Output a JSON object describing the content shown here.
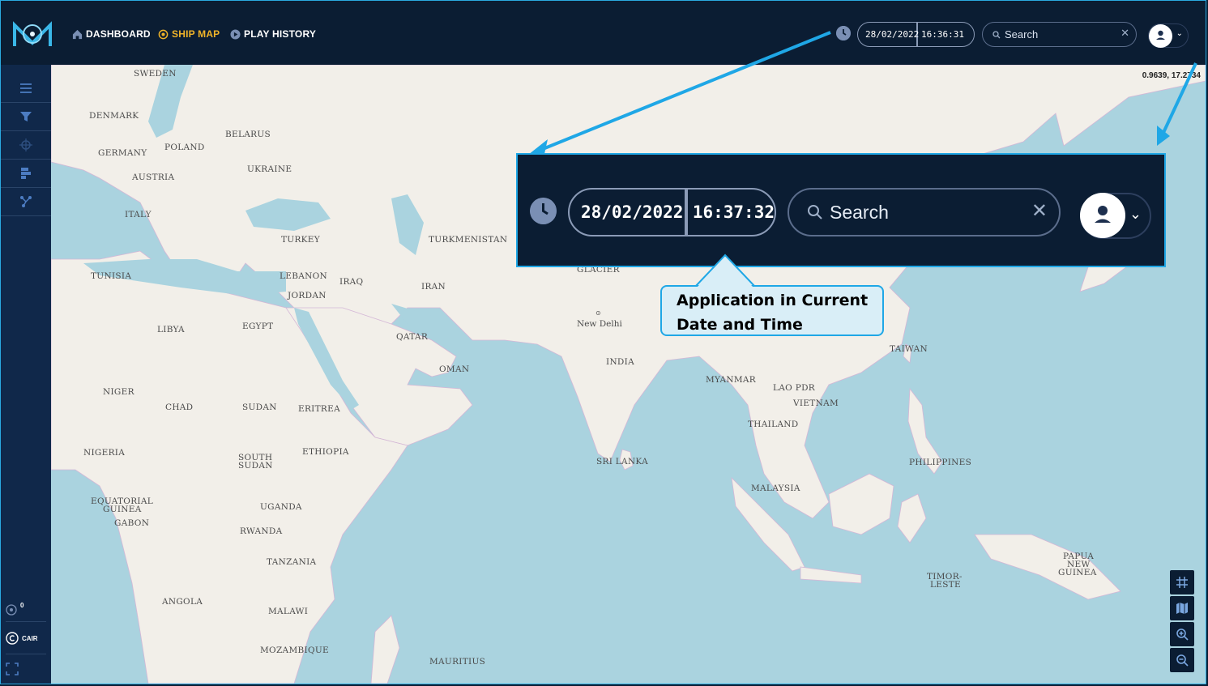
{
  "nav": {
    "dashboard": "DASHBOARD",
    "ship_map": "SHIP MAP",
    "play_history": "PLAY HISTORY"
  },
  "header": {
    "date": "28/02/2022",
    "time_small": "16:36:31",
    "time": "16:37:32",
    "search_placeholder": "Search"
  },
  "sidebar": {
    "icons": [
      "menu-icon",
      "filter-icon",
      "crosshair-icon",
      "layers-icon",
      "network-icon"
    ],
    "bottom": {
      "zoom_level": "0",
      "brand": "CAIR"
    }
  },
  "map": {
    "coordinates": "0.9639, 17.2734",
    "labels": {
      "sweden": "SWEDEN",
      "denmark": "DENMARK",
      "belarus": "BELARUS",
      "germany": "GERMANY",
      "poland": "POLAND",
      "ukraine": "UKRAINE",
      "austria": "AUSTRIA",
      "italy": "ITALY",
      "turkey": "TURKEY",
      "turkmenistan": "TURKMENISTAN",
      "tunisia": "TUNISIA",
      "lebanon": "LEBANON",
      "iraq": "IRAQ",
      "iran": "IRAN",
      "jordan": "JORDAN",
      "libya": "LIBYA",
      "egypt": "EGYPT",
      "qatar": "QATAR",
      "oman": "OMAN",
      "glacier": "GLACIER",
      "new_delhi": "New Delhi",
      "india": "INDIA",
      "myanmar": "MYANMAR",
      "lao": "LAO PDR",
      "vietnam": "VIETNAM",
      "thailand": "THAILAND",
      "taiwan": "TAIWAN",
      "niger": "NIGER",
      "chad": "CHAD",
      "sudan": "SUDAN",
      "eritrea": "ERITREA",
      "nigeria": "NIGERIA",
      "ethiopia": "ETHIOPIA",
      "south_sudan_1": "SOUTH",
      "south_sudan_2": "SUDAN",
      "sri_lanka": "SRI LANKA",
      "philippines": "PHILIPPINES",
      "eq_guinea_1": "EQUATORIAL",
      "eq_guinea_2": "GUINEA",
      "gabon": "GABON",
      "uganda": "UGANDA",
      "malaysia": "MALAYSIA",
      "rwanda": "RWANDA",
      "tanzania": "TANZANIA",
      "timor_1": "TIMOR-",
      "timor_2": "LESTE",
      "png_1": "PAPUA",
      "png_2": "NEW",
      "png_3": "GUINEA",
      "angola": "ANGOLA",
      "malawi": "MALAWI",
      "mozambique": "MOZAMBIQUE",
      "mauritius": "MAURITIUS"
    },
    "controls": [
      "grid-icon",
      "map-layers-icon",
      "zoom-in-icon",
      "zoom-out-icon"
    ]
  },
  "callout": {
    "line1": "Application in Current",
    "line2": "Date and Time"
  },
  "colors": {
    "navbar": "#0b1d33",
    "sidebar": "#10284a",
    "accent": "#f0b429",
    "annotation": "#1fa7e6",
    "water": "#aad3df",
    "land": "#f2efe9"
  }
}
